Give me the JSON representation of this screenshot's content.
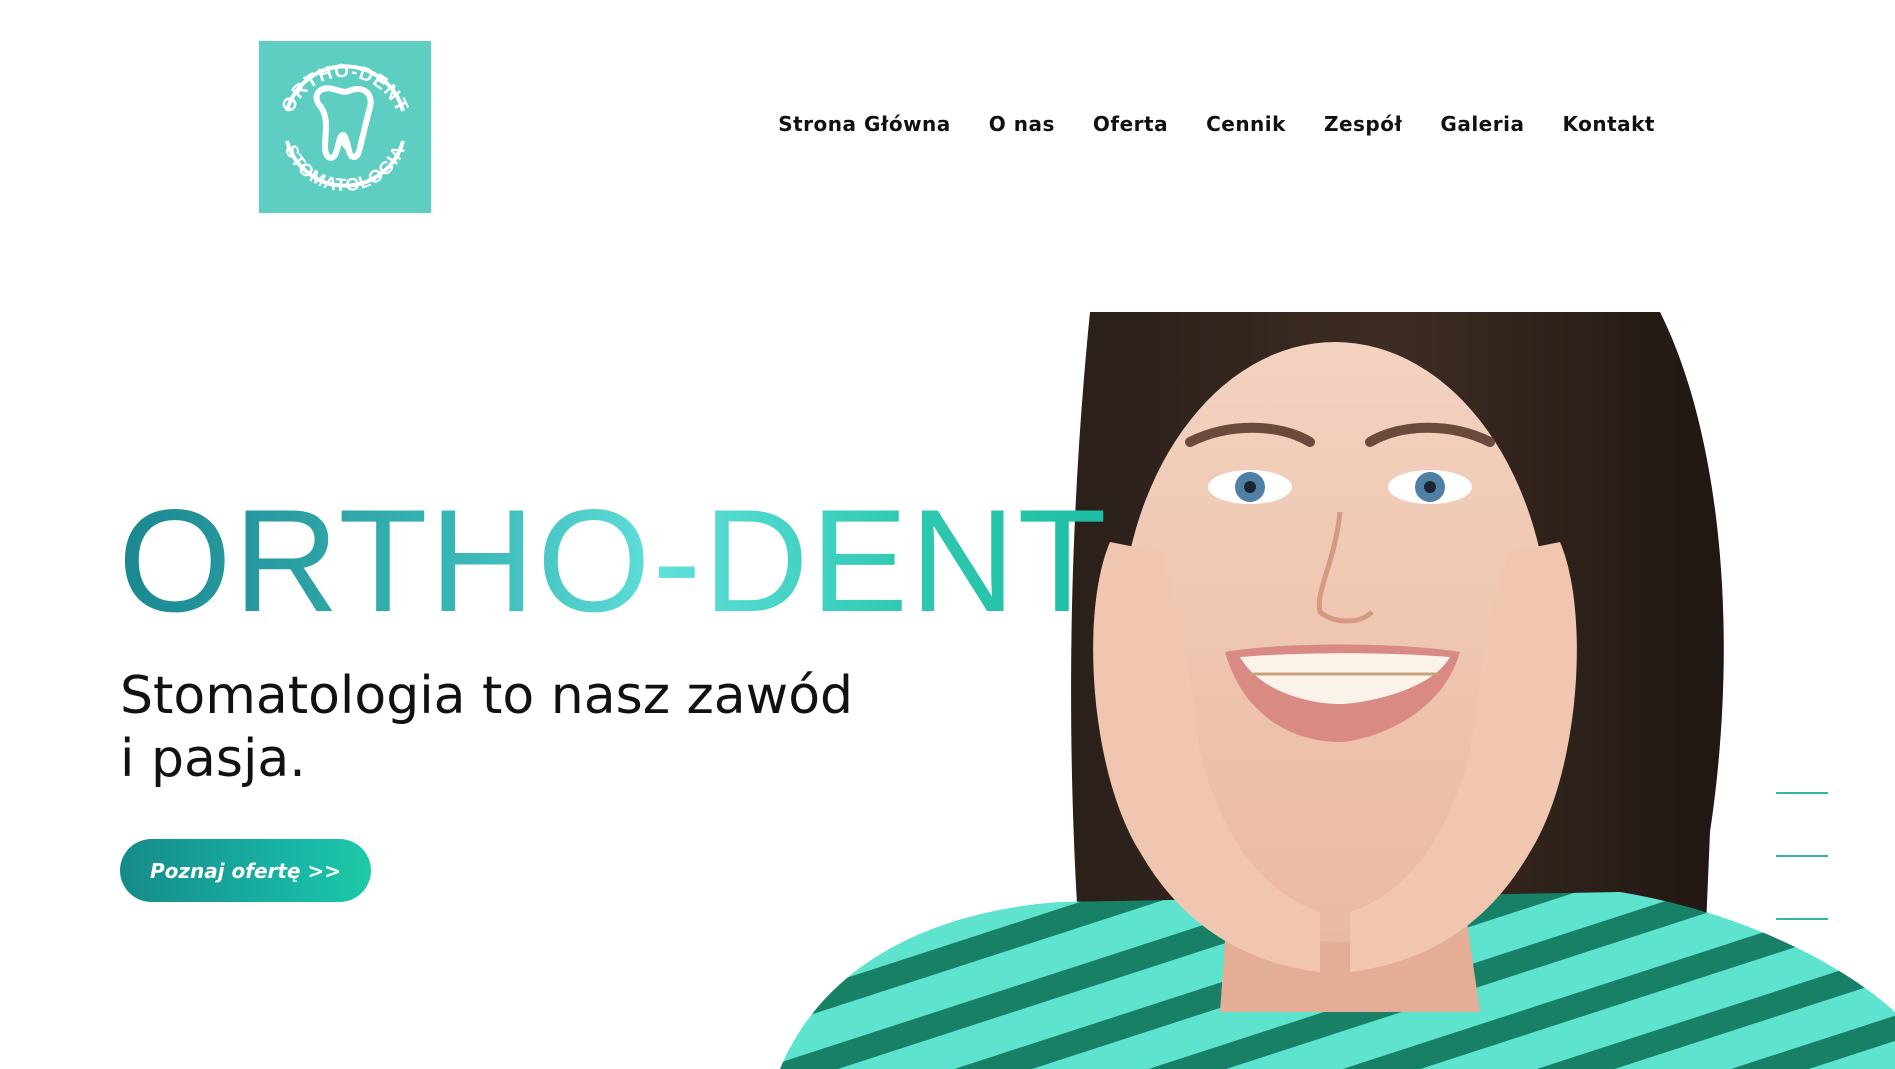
{
  "logo": {
    "text_top": "ORTHO-DENT",
    "text_bottom": "STOMATOLOGIA",
    "background": "#5ecdc2"
  },
  "nav": {
    "items": [
      {
        "label": "Strona Główna"
      },
      {
        "label": "O nas"
      },
      {
        "label": "Oferta"
      },
      {
        "label": "Cennik"
      },
      {
        "label": "Zespół"
      },
      {
        "label": "Galeria"
      },
      {
        "label": "Kontakt"
      }
    ]
  },
  "hero": {
    "title": "ORTHO-DENT",
    "subtitle": "Stomatologia to nasz zawód i pasja.",
    "cta_label": "Poznaj ofertę >>",
    "accent_start": "#168a8a",
    "accent_end": "#1ecaa7"
  },
  "slider": {
    "slide_count": 3
  }
}
